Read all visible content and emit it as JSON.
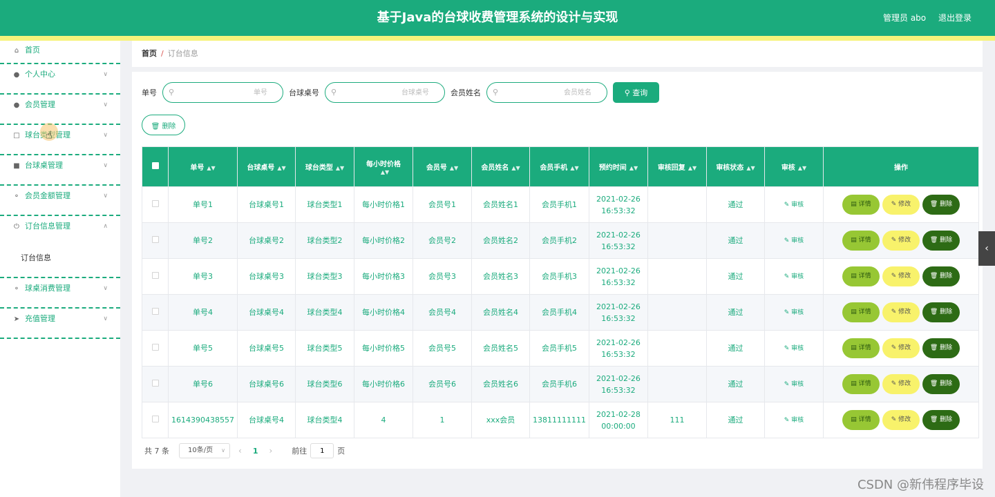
{
  "header": {
    "title": "基于Java的台球收费管理系统的设计与实现",
    "user": "管理员 abo",
    "logout": "退出登录"
  },
  "sidebar": {
    "items": [
      {
        "label": "首页",
        "icon": "home-icon"
      },
      {
        "label": "个人中心",
        "icon": "user-icon"
      },
      {
        "label": "会员管理",
        "icon": "user-icon"
      },
      {
        "label": "球台类型管理",
        "icon": "card-icon"
      },
      {
        "label": "台球桌管理",
        "icon": "desk-icon"
      },
      {
        "label": "会员金额管理",
        "icon": "mic-icon"
      },
      {
        "label": "订台信息管理",
        "icon": "power-icon"
      },
      {
        "label": "订台信息",
        "icon": ""
      },
      {
        "label": "球桌消费管理",
        "icon": "mic-icon"
      },
      {
        "label": "充值管理",
        "icon": "send-icon"
      }
    ]
  },
  "breadcrumb": {
    "home": "首页",
    "separator": "/",
    "current": "订台信息"
  },
  "search": {
    "label1": "单号",
    "placeholder1": "单号",
    "label2": "台球桌号",
    "placeholder2": "台球桌号",
    "label3": "会员姓名",
    "placeholder3": "会员姓名",
    "query_label": "查询"
  },
  "toolbar": {
    "delete_label": "删除"
  },
  "table": {
    "headers": [
      "单号",
      "台球桌号",
      "球台类型",
      "每小时价格",
      "会员号",
      "会员姓名",
      "会员手机",
      "预约时间",
      "审核回复",
      "审核状态",
      "审核",
      "操作"
    ],
    "rows": [
      {
        "order_no": "单号1",
        "desk_no": "台球桌号1",
        "table_type": "球台类型1",
        "price": "每小时价格1",
        "member_no": "会员号1",
        "member_name": "会员姓名1",
        "phone": "会员手机1",
        "time": "2021-02-26 16:53:32",
        "reply": "",
        "status": "通过"
      },
      {
        "order_no": "单号2",
        "desk_no": "台球桌号2",
        "table_type": "球台类型2",
        "price": "每小时价格2",
        "member_no": "会员号2",
        "member_name": "会员姓名2",
        "phone": "会员手机2",
        "time": "2021-02-26 16:53:32",
        "reply": "",
        "status": "通过"
      },
      {
        "order_no": "单号3",
        "desk_no": "台球桌号3",
        "table_type": "球台类型3",
        "price": "每小时价格3",
        "member_no": "会员号3",
        "member_name": "会员姓名3",
        "phone": "会员手机3",
        "time": "2021-02-26 16:53:32",
        "reply": "",
        "status": "通过"
      },
      {
        "order_no": "单号4",
        "desk_no": "台球桌号4",
        "table_type": "球台类型4",
        "price": "每小时价格4",
        "member_no": "会员号4",
        "member_name": "会员姓名4",
        "phone": "会员手机4",
        "time": "2021-02-26 16:53:32",
        "reply": "",
        "status": "通过"
      },
      {
        "order_no": "单号5",
        "desk_no": "台球桌号5",
        "table_type": "球台类型5",
        "price": "每小时价格5",
        "member_no": "会员号5",
        "member_name": "会员姓名5",
        "phone": "会员手机5",
        "time": "2021-02-26 16:53:32",
        "reply": "",
        "status": "通过"
      },
      {
        "order_no": "单号6",
        "desk_no": "台球桌号6",
        "table_type": "球台类型6",
        "price": "每小时价格6",
        "member_no": "会员号6",
        "member_name": "会员姓名6",
        "phone": "会员手机6",
        "time": "2021-02-26 16:53:32",
        "reply": "",
        "status": "通过"
      },
      {
        "order_no": "1614390438557",
        "desk_no": "台球桌号4",
        "table_type": "球台类型4",
        "price": "4",
        "member_no": "1",
        "member_name": "xxx会员",
        "phone": "13811111111",
        "time": "2021-02-28 00:00:00",
        "reply": "111",
        "status": "通过"
      }
    ],
    "audit_label": "审核",
    "detail_label": "详情",
    "edit_label": "修改",
    "delete_label": "删除"
  },
  "pagination": {
    "total": "共 7 条",
    "page_size": "10条/页",
    "current_page": "1",
    "goto_label": "前往",
    "goto_value": "1",
    "page_suffix": "页"
  },
  "watermark": "CSDN @新伟程序毕设",
  "colors": {
    "primary": "#1bab7d",
    "stripe": "#f7f37b",
    "detail": "#97c734",
    "edit": "#f8f26b",
    "delete": "#2d6b15"
  }
}
